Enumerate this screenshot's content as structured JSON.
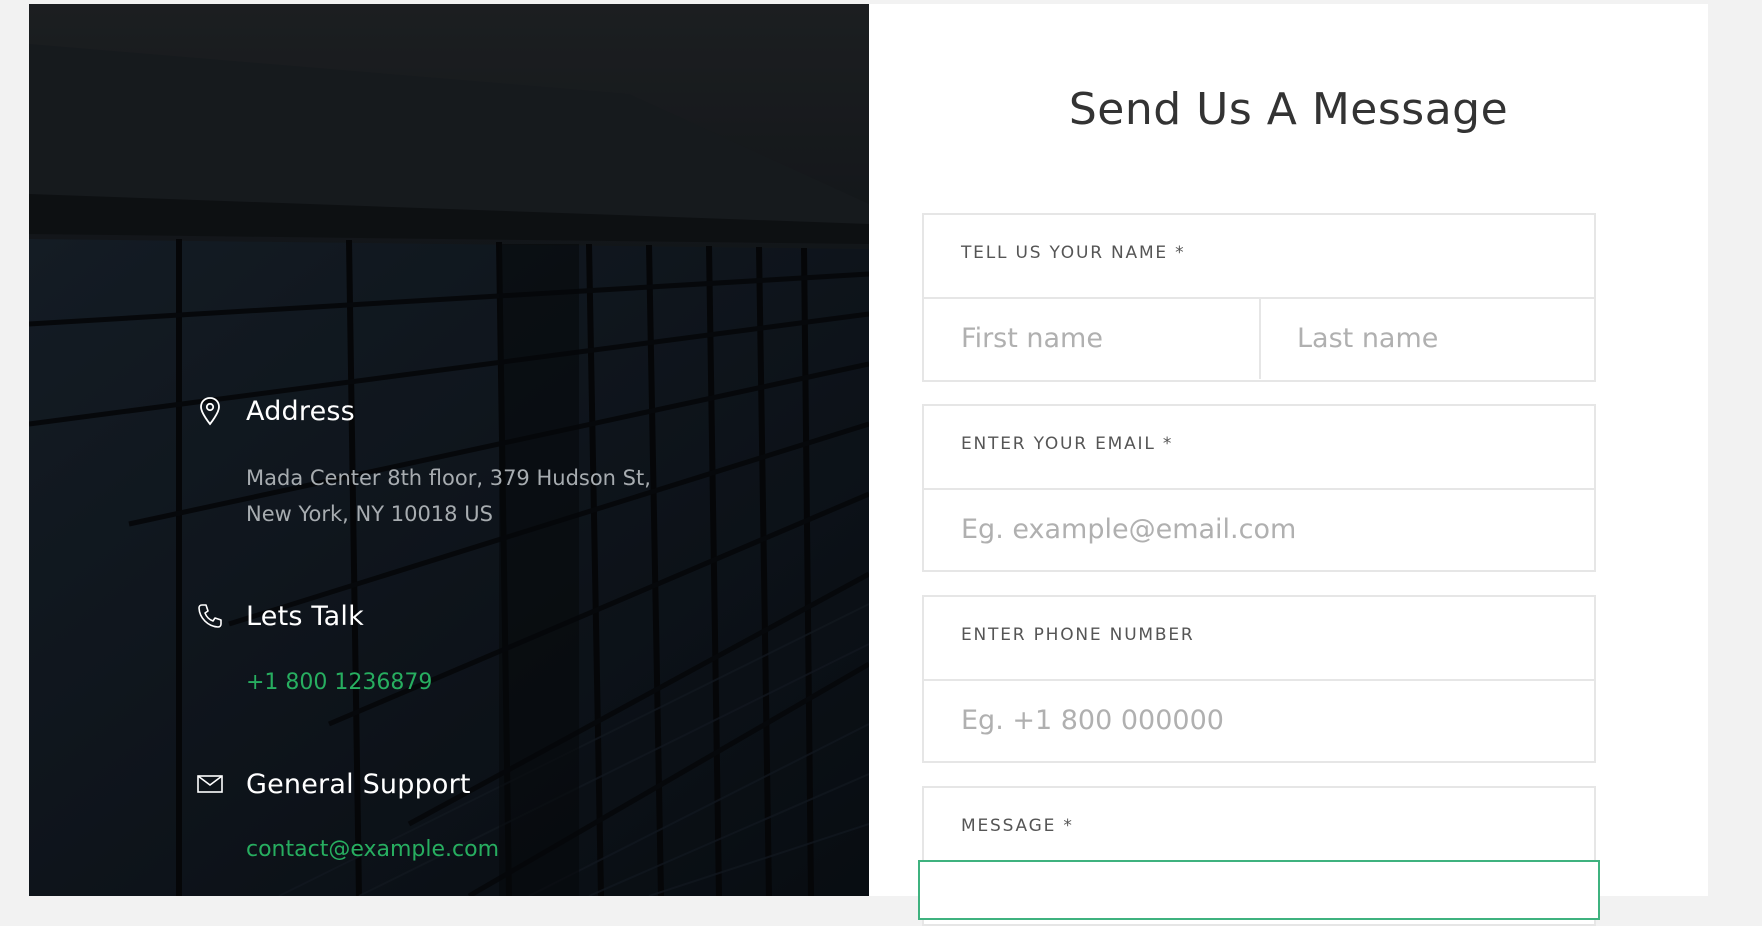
{
  "contact_info": {
    "address": {
      "icon": "map-pin-icon",
      "title": "Address",
      "line1": "Mada Center 8th floor, 379 Hudson St,",
      "line2": "New York, NY 10018 US"
    },
    "talk": {
      "icon": "phone-icon",
      "title": "Lets Talk",
      "phone": "+1 800 1236879"
    },
    "support": {
      "icon": "envelope-icon",
      "title": "General Support",
      "email": "contact@example.com"
    },
    "link_color": "#27ae60"
  },
  "form": {
    "title": "Send Us A Message",
    "name": {
      "label": "TELL US YOUR NAME *",
      "first_placeholder": "First name",
      "last_placeholder": "Last name"
    },
    "email": {
      "label": "ENTER YOUR EMAIL *",
      "placeholder": "Eg. example@email.com"
    },
    "phone": {
      "label": "ENTER PHONE NUMBER",
      "placeholder": "Eg. +1 800 000000"
    },
    "message": {
      "label": "MESSAGE *",
      "focus_color": "#3fb27f"
    }
  }
}
